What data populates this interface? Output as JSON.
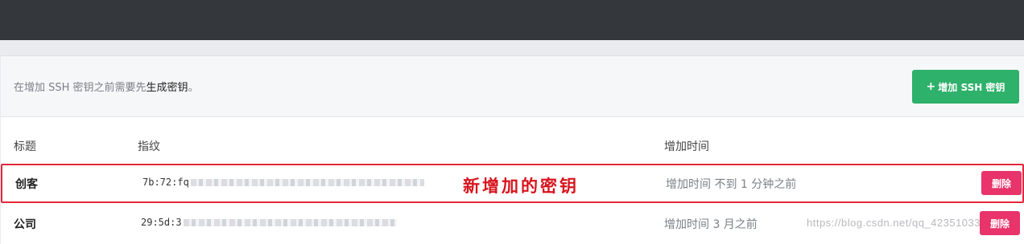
{
  "notice": {
    "prefix": "在增加 SSH 密钥之前需要先",
    "link": "生成密钥",
    "suffix": "。"
  },
  "add_button": {
    "icon": "plus-icon",
    "label": "增加 SSH 密钥"
  },
  "table": {
    "headers": {
      "title": "标题",
      "fingerprint": "指纹",
      "added_time": "增加时间"
    },
    "rows": [
      {
        "title": "创客",
        "fingerprint": "7b:72:fq",
        "added_time": "增加时间 不到 1 分钟之前",
        "delete": "删除"
      },
      {
        "title": "公司",
        "fingerprint": "29:5d:3",
        "added_time": "增加时间 3 月之前",
        "delete": "删除"
      }
    ]
  },
  "annotation": "新增加的密钥",
  "watermark": "https://blog.csdn.net/qq_42351033",
  "colors": {
    "topbar": "#34373b",
    "add_button": "#2eb16a",
    "delete_button": "#e8336b",
    "highlight": "#e3283c"
  }
}
